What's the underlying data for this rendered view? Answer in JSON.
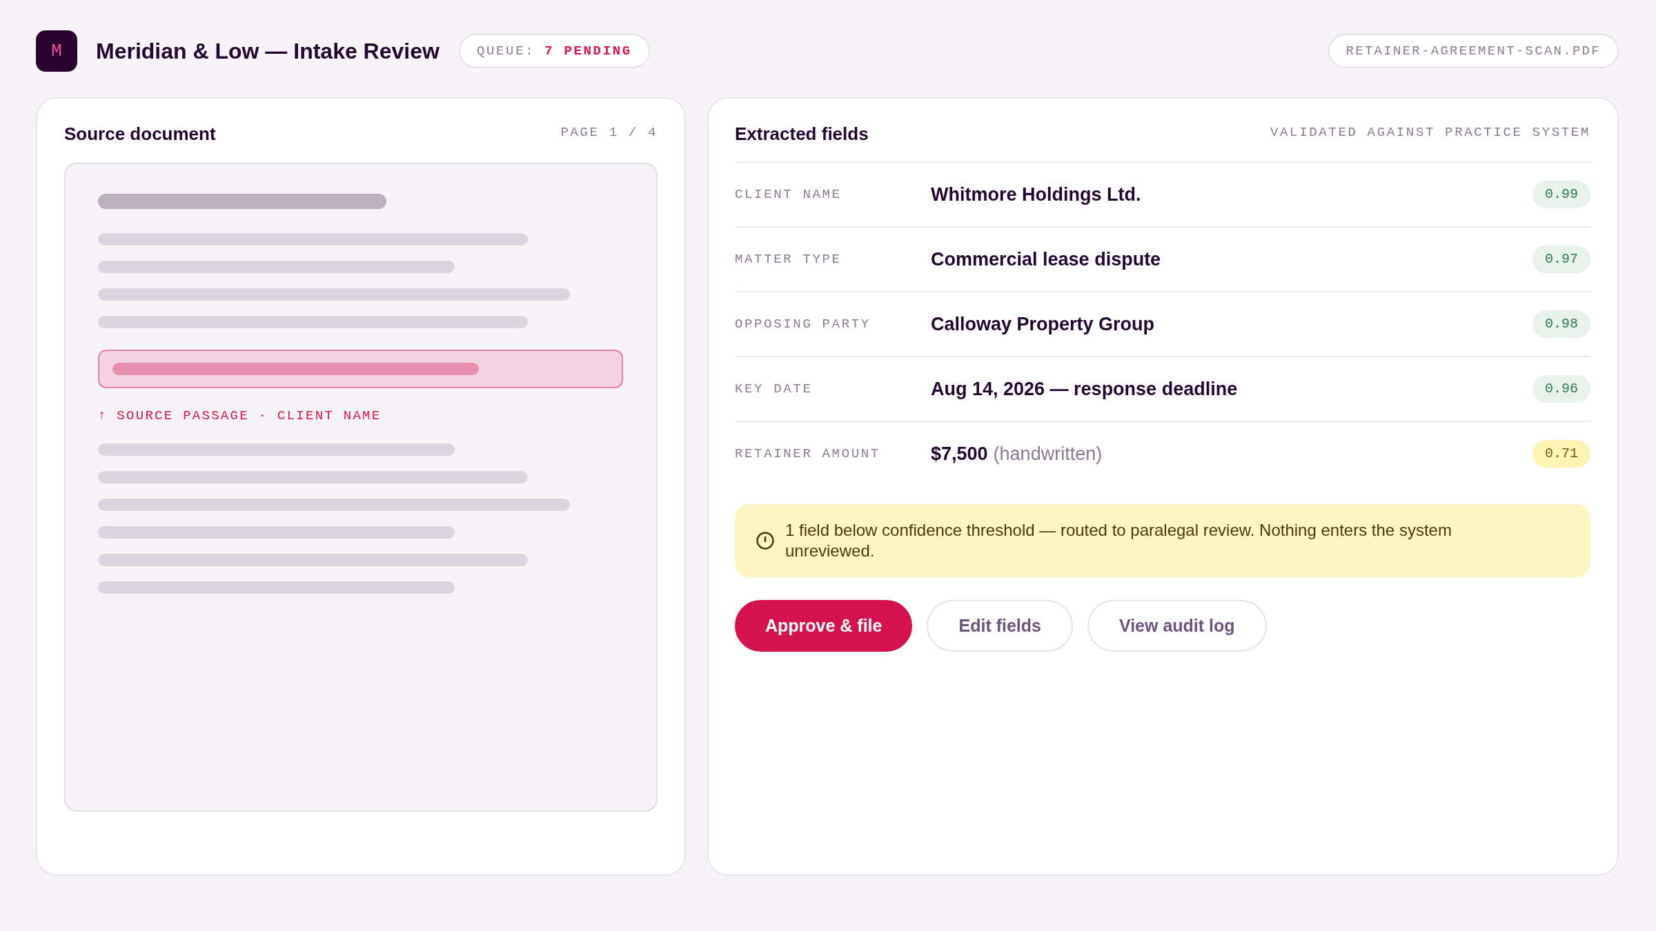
{
  "header": {
    "logo": "M",
    "title": "Meridian & Low — Intake Review",
    "queue": {
      "label": "QUEUE:",
      "count": "7 PENDING"
    },
    "file_name": "RETAINER-AGREEMENT-SCAN.PDF"
  },
  "source_panel": {
    "title": "Source document",
    "page": "PAGE 1 / 4",
    "passage_label": "↑ SOURCE PASSAGE · CLIENT NAME"
  },
  "fields_panel": {
    "title": "Extracted fields",
    "status": "VALIDATED AGAINST PRACTICE SYSTEM",
    "fields": [
      {
        "label": "CLIENT NAME",
        "value": "Whitmore Holdings Ltd.",
        "confidence": "0.99",
        "low_confidence": false
      },
      {
        "label": "MATTER TYPE",
        "value": "Commercial lease dispute",
        "confidence": "0.97",
        "low_confidence": false
      },
      {
        "label": "OPPOSING PARTY",
        "value": "Calloway Property Group",
        "confidence": "0.98",
        "low_confidence": false
      },
      {
        "label": "KEY DATE",
        "value": "Aug 14, 2026 — response deadline",
        "confidence": "0.96",
        "low_confidence": false
      },
      {
        "label": "RETAINER AMOUNT",
        "value": "$7,500",
        "note": "(handwritten)",
        "confidence": "0.71",
        "low_confidence": true
      }
    ],
    "notice": "1 field below confidence threshold — routed to paralegal review. Nothing enters the system unreviewed.",
    "actions": [
      {
        "label": "Approve & file",
        "kind": "primary"
      },
      {
        "label": "Edit fields",
        "kind": "secondary"
      },
      {
        "label": "View audit log",
        "kind": "secondary"
      }
    ]
  }
}
